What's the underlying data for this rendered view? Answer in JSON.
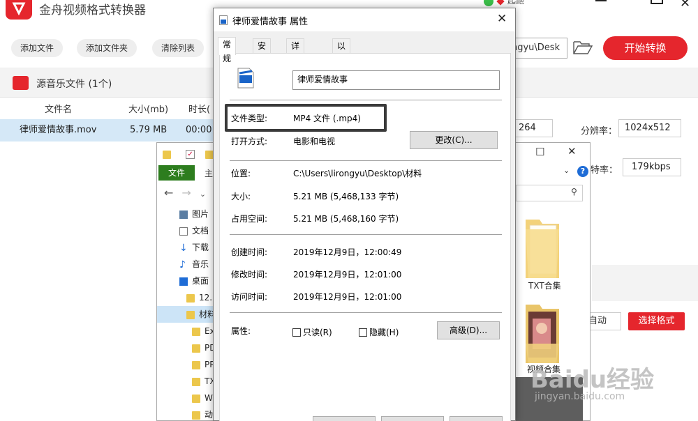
{
  "app": {
    "title": "金舟视频格式转换器",
    "user_name": "起跑",
    "toolbar": {
      "add_file": "添加文件",
      "add_folder": "添加文件夹",
      "clear_list": "清除列表",
      "output_path": "ngyu\\Desk",
      "start_convert": "开始转换"
    },
    "source_section": {
      "title": "源音乐文件 (1个)"
    },
    "columns": {
      "filename": "文件名",
      "size": "大小(mb)",
      "duration": "时长("
    },
    "file_row": {
      "name": "律师爱情故事.mov",
      "size": "5.79 MB",
      "duration": "00:00:"
    },
    "format": {
      "codec_value": "264",
      "resolution_label": "分辨率：",
      "resolution_value": "1024x512",
      "bitrate_label": "特率：",
      "bitrate_value": "179kbps",
      "auto": "自动",
      "select_format": "选择格式"
    },
    "watermark": {
      "brand": "Baidu经验",
      "url": "jingyan.baidu.com"
    }
  },
  "explorer": {
    "tab_file": "文件",
    "tab_home": "主",
    "tree": [
      {
        "label": "图片",
        "icon": "pictures-icon"
      },
      {
        "label": "文档",
        "icon": "documents-icon"
      },
      {
        "label": "下载",
        "icon": "download-icon"
      },
      {
        "label": "音乐",
        "icon": "music-icon"
      },
      {
        "label": "桌面",
        "icon": "desktop-icon"
      },
      {
        "label": "12.",
        "icon": "folder-icon"
      },
      {
        "label": "材料",
        "icon": "folder-icon"
      },
      {
        "label": "Ex",
        "icon": "folder-icon"
      },
      {
        "label": "PD",
        "icon": "folder-icon"
      },
      {
        "label": "PP",
        "icon": "folder-icon"
      },
      {
        "label": "TX",
        "icon": "folder-icon"
      },
      {
        "label": "W",
        "icon": "folder-icon"
      },
      {
        "label": "动",
        "icon": "folder-icon"
      }
    ],
    "items": [
      {
        "label": "TXT合集"
      },
      {
        "label": "视频合集"
      }
    ]
  },
  "properties": {
    "title": "律师爱情故事 属性",
    "tabs": [
      "常规",
      "安全",
      "详细信息",
      "以前的版本"
    ],
    "file_name": "律师爱情故事",
    "file_type_label": "文件类型:",
    "file_type_value": "MP4 文件 (.mp4)",
    "open_with_label": "打开方式:",
    "open_with_value": "电影和电视",
    "change_button": "更改(C)...",
    "location_label": "位置:",
    "location_value": "C:\\Users\\lirongyu\\Desktop\\材料",
    "size_label": "大小:",
    "size_value": "5.21 MB (5,468,133 字节)",
    "disk_size_label": "占用空间:",
    "disk_size_value": "5.21 MB (5,468,160 字节)",
    "created_label": "创建时间:",
    "created_value": "2019年12月9日，12:00:49",
    "modified_label": "修改时间:",
    "modified_value": "2019年12月9日，12:01:00",
    "accessed_label": "访问时间:",
    "accessed_value": "2019年12月9日，12:01:00",
    "attributes_label": "属性:",
    "readonly_label": "只读(R)",
    "hidden_label": "隐藏(H)",
    "advanced_button": "高级(D)..."
  }
}
